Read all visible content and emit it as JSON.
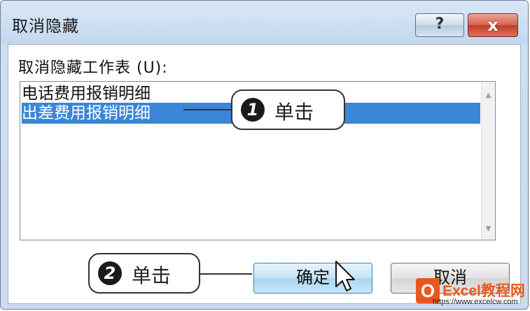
{
  "window": {
    "title": "取消隐藏",
    "help_label": "?",
    "close_label": "x"
  },
  "content": {
    "label": "取消隐藏工作表 (U):",
    "sheets": [
      "电话费用报销明细",
      "出差费用报销明细"
    ],
    "selected_index": 1
  },
  "buttons": {
    "ok_label": "确定",
    "cancel_label": "取消"
  },
  "callouts": [
    {
      "number": "1",
      "text": "单击"
    },
    {
      "number": "2",
      "text": "单击"
    }
  ],
  "watermark": {
    "logo": "O",
    "name": "Excel教程网",
    "url": "https://www.excelcw.com"
  },
  "colors": {
    "selection": "#3b86d8",
    "close_button": "#c33b26",
    "title_bar": "#c4d8ee"
  }
}
